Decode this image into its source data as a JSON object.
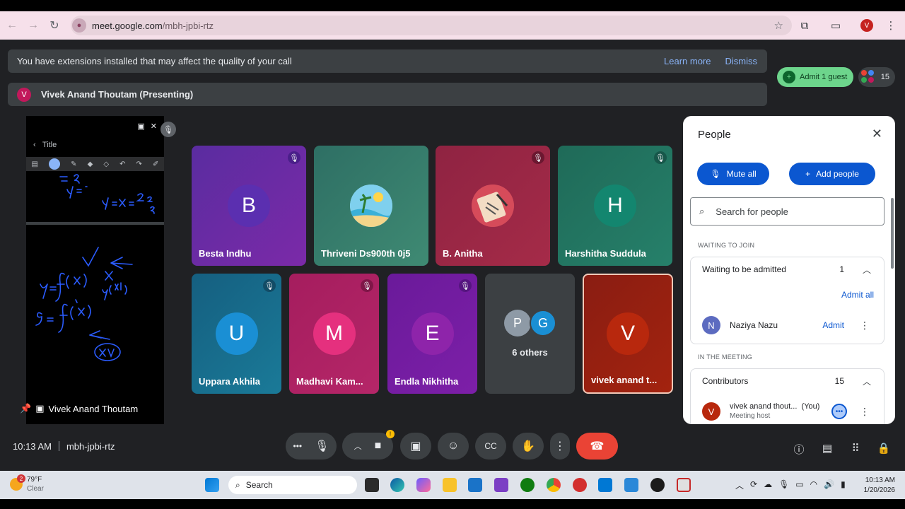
{
  "browser": {
    "url_host": "meet.google.com",
    "url_path": "/mbh-jpbi-rtz",
    "profile_initial": "V"
  },
  "banner": {
    "message": "You have extensions installed that may affect the quality of your call",
    "learn_more": "Learn more",
    "dismiss": "Dismiss"
  },
  "presenting": {
    "initial": "V",
    "label": "Vivek Anand Thoutam (Presenting)",
    "presenter_name": "Vivek Anand Thoutam",
    "note_title": "Title"
  },
  "top_right": {
    "admit_label": "Admit 1 guest",
    "participant_count": "15"
  },
  "tiles": [
    {
      "name": "Besta Indhu",
      "initial": "B"
    },
    {
      "name": "Thriveni Ds900th 0j5",
      "initial": ""
    },
    {
      "name": "B. Anitha",
      "initial": ""
    },
    {
      "name": "Harshitha Suddula",
      "initial": "H"
    },
    {
      "name": "Uppara Akhila",
      "initial": "U"
    },
    {
      "name": "Madhavi Kam...",
      "initial": "M"
    },
    {
      "name": "Endla Nikhitha",
      "initial": "E"
    },
    {
      "name": "vivek anand t...",
      "initial": "V"
    }
  ],
  "others": {
    "label": "6 others",
    "initials": [
      "P",
      "G"
    ]
  },
  "people_panel": {
    "title": "People",
    "mute_all": "Mute all",
    "add_people": "Add people",
    "search_placeholder": "Search for people",
    "waiting_section": "WAITING TO JOIN",
    "waiting_header": "Waiting to be admitted",
    "waiting_count": "1",
    "admit_all": "Admit all",
    "waiting_person": {
      "name": "Naziya Nazu",
      "initial": "N",
      "action": "Admit"
    },
    "meeting_section": "IN THE MEETING",
    "contributors_header": "Contributors",
    "contributors_count": "15",
    "host": {
      "name": "vivek anand thout...",
      "you": "(You)",
      "role": "Meeting host",
      "initial": "V"
    }
  },
  "bottom_bar": {
    "time": "10:13 AM",
    "meeting_code": "mbh-jpbi-rtz"
  },
  "taskbar": {
    "temp": "79°F",
    "condition": "Clear",
    "weather_badge": "2",
    "search": "Search",
    "clock_time": "10:13 AM",
    "clock_date": "1/20/2026"
  },
  "colors": {
    "meet_bg": "#202124",
    "accent_blue": "#0b57d0",
    "end_call_red": "#ea4335",
    "admit_green": "#6dd58c"
  }
}
